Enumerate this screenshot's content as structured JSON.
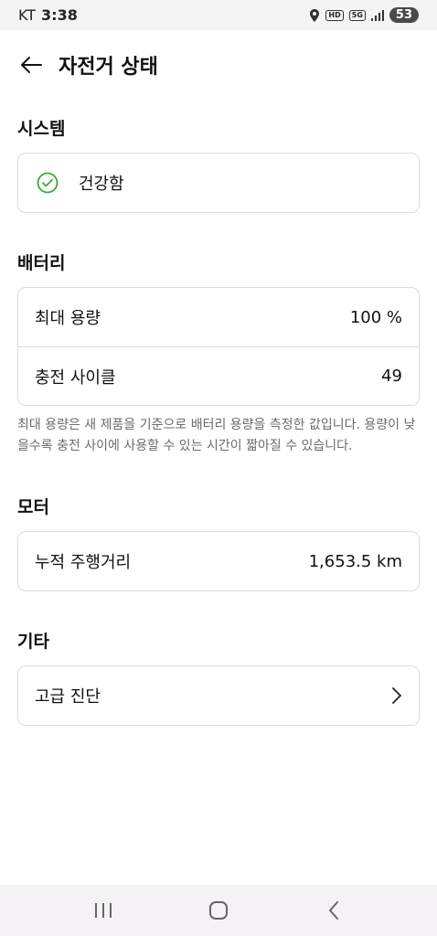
{
  "status_bar": {
    "carrier": "KT",
    "time": "3:38",
    "hd_label": "HD",
    "network_label": "5G",
    "battery": "53"
  },
  "header": {
    "title": "자전거 상태"
  },
  "system": {
    "title": "시스템",
    "status": "건강함"
  },
  "battery_section": {
    "title": "배터리",
    "rows": [
      {
        "label": "최대 용량",
        "value": "100 %"
      },
      {
        "label": "충전 사이클",
        "value": "49"
      }
    ],
    "note": "최대 용량은 새 제품을 기준으로 배터리 용량을 측정한 값입니다. 용량이 낮을수록 충전 사이에 사용할 수 있는 시간이 짧아질 수 있습니다."
  },
  "motor": {
    "title": "모터",
    "rows": [
      {
        "label": "누적 주행거리",
        "value": "1,653.5 km"
      }
    ]
  },
  "other": {
    "title": "기타",
    "rows": [
      {
        "label": "고급 진단"
      }
    ]
  },
  "colors": {
    "accent_green": "#3aaa35",
    "card_border": "#dcdcdc",
    "note_text": "#6b6b6b"
  },
  "icons": [
    "back-arrow-icon",
    "check-circle-icon",
    "chevron-right-icon",
    "recents-icon",
    "home-icon",
    "nav-back-icon"
  ]
}
